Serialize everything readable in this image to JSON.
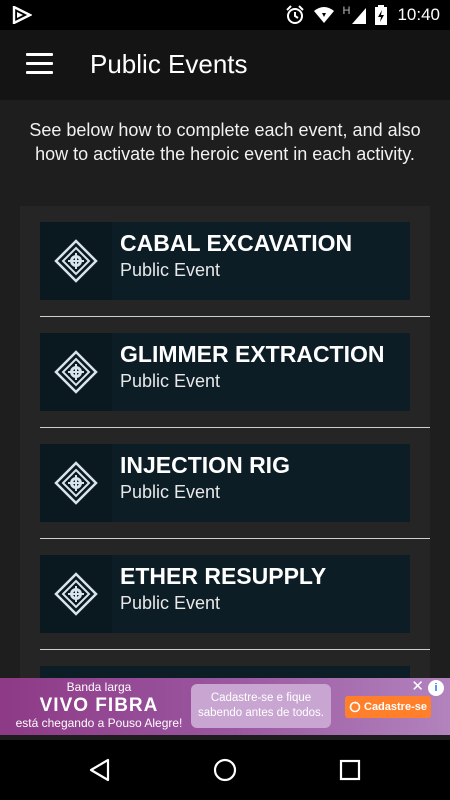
{
  "status_bar": {
    "time": "10:40",
    "network_letter": "H"
  },
  "app_bar": {
    "title": "Public Events"
  },
  "intro_text": "See below how to complete each event, and also how to activate the heroic event in each activity.",
  "events": [
    {
      "name": "CABAL EXCAVATION",
      "subtitle": "Public Event"
    },
    {
      "name": "GLIMMER EXTRACTION",
      "subtitle": "Public Event"
    },
    {
      "name": "INJECTION RIG",
      "subtitle": "Public Event"
    },
    {
      "name": "ETHER RESUPPLY",
      "subtitle": "Public Event"
    }
  ],
  "ad": {
    "line1": "Banda larga",
    "line2": "VIVO FIBRA",
    "line3": "está chegando a Pouso Alegre!",
    "bubble": "Cadastre-se e fique sabendo antes de todos.",
    "cta": "Cadastre-se",
    "colors": {
      "primary": "#8e3a86",
      "cta": "#ff7f2a"
    }
  },
  "colors": {
    "background": "#1e1e1e",
    "app_bar": "#141414",
    "event_card": "#0c1d26"
  }
}
